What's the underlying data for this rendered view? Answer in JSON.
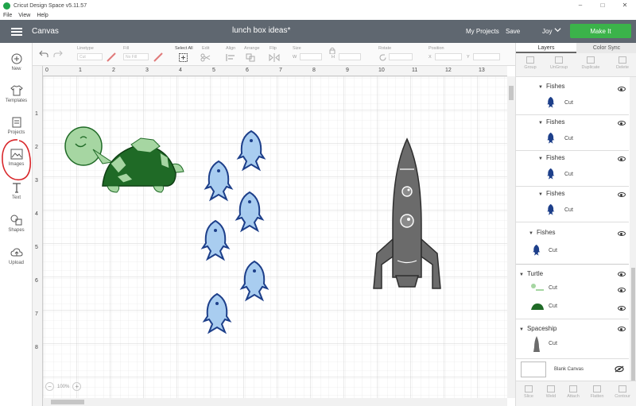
{
  "window": {
    "title": "Cricut Design Space  v5.11.57",
    "controls": [
      "–",
      "□",
      "✕"
    ]
  },
  "menu": [
    "File",
    "View",
    "Help"
  ],
  "header": {
    "canvas_label": "Canvas",
    "project_title": "lunch box ideas*",
    "my_projects": "My Projects",
    "save": "Save",
    "user": "Joy",
    "make_it": "Make It",
    "accent_color": "#3bb34a",
    "bar_color": "#5f6770"
  },
  "left_tools": [
    {
      "label": "New",
      "icon": "plus-circle-icon"
    },
    {
      "label": "Templates",
      "icon": "shirt-icon"
    },
    {
      "label": "Projects",
      "icon": "projects-icon"
    },
    {
      "label": "Images",
      "icon": "image-icon"
    },
    {
      "label": "Text",
      "icon": "text-icon"
    },
    {
      "label": "Shapes",
      "icon": "shapes-icon"
    },
    {
      "label": "Upload",
      "icon": "upload-cloud-icon"
    }
  ],
  "toolbar": {
    "linetype_label": "Linetype",
    "linetype_value": "Cut",
    "fill_label": "Fill",
    "fill_value": "No Fill",
    "select_all": "Select All",
    "edit": "Edit",
    "align": "Align",
    "arrange": "Arrange",
    "flip": "Flip",
    "size": "Size",
    "w": "W",
    "h": "H",
    "rotate": "Rotate",
    "position": "Position",
    "x": "X",
    "y": "Y"
  },
  "ruler": {
    "h": [
      "0",
      "1",
      "2",
      "3",
      "4",
      "5",
      "6",
      "7",
      "8",
      "9",
      "10",
      "11",
      "12",
      "13"
    ],
    "v": [
      "1",
      "2",
      "3",
      "4",
      "5",
      "6",
      "7",
      "8"
    ]
  },
  "zoom": {
    "minus": "−",
    "value": "100%",
    "plus": "+"
  },
  "right_panel": {
    "tabs": [
      "Layers",
      "Color Sync"
    ],
    "top_actions": [
      "Group",
      "UnGroup",
      "Duplicate",
      "Delete"
    ],
    "groups": [
      {
        "name": "Fishes",
        "child": "Cut"
      },
      {
        "name": "Fishes",
        "child": "Cut"
      },
      {
        "name": "Fishes",
        "child": "Cut"
      },
      {
        "name": "Fishes",
        "child": "Cut"
      },
      {
        "name": "Fishes",
        "child": "Cut"
      },
      {
        "name": "Turtle",
        "children": [
          "Cut",
          "Cut"
        ]
      },
      {
        "name": "Spaceship",
        "child": "Cut"
      }
    ],
    "blank_canvas": "Blank Canvas",
    "bottom_actions": [
      "Slice",
      "Weld",
      "Attach",
      "Flatten",
      "Contour"
    ]
  },
  "colors": {
    "fish_light": "#a9cdf0",
    "fish_dark": "#1d3f8a",
    "turtle_light": "#a6d6a2",
    "turtle_dark": "#1f6a26",
    "rocket": "#6b6b6b",
    "annotation": "#d8262a"
  }
}
